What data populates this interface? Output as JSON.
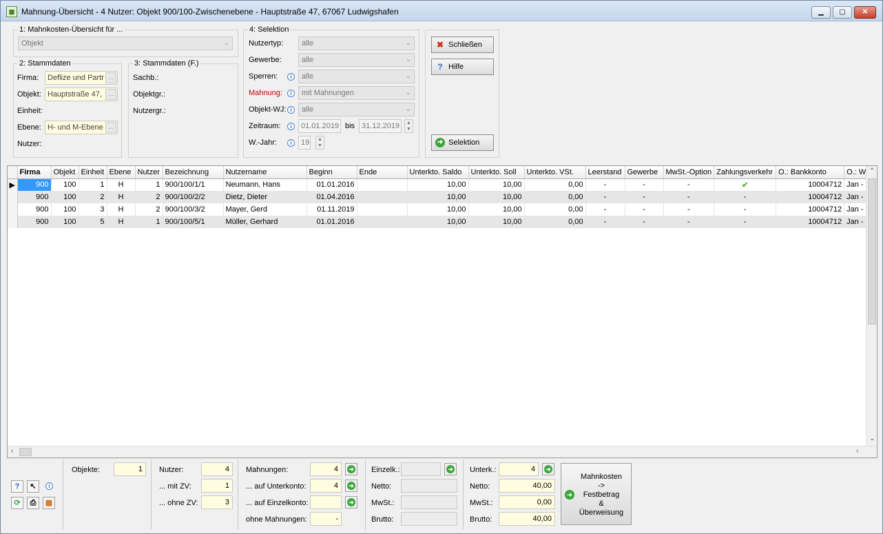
{
  "window": {
    "title": "Mahnung-Übersicht - 4 Nutzer:  Objekt 900/100-Zwischenebene - Hauptstraße 47, 67067 Ludwigshafen",
    "icon_name": "app-icon",
    "min_label": "▁",
    "max_label": "▢",
    "close_label": "✕"
  },
  "group1": {
    "title": "1: Mahnkosten-Übersicht für ...",
    "combo_value": "Objekt"
  },
  "group2": {
    "title": "2: Stammdaten",
    "firma_label": "Firma:",
    "firma_value": "Deflize und Partr",
    "objekt_label": "Objekt:",
    "objekt_value": "Hauptstraße 47,",
    "einheit_label": "Einheit:",
    "ebene_label": "Ebene:",
    "ebene_value": "H- und M-Ebene",
    "nutzer_label": "Nutzer:",
    "dots": "..."
  },
  "group3": {
    "title": "3: Stammdaten (F.)",
    "sachb_label": "Sachb.:",
    "objektgr_label": "Objektgr.:",
    "nutzergr_label": "Nutzergr.:"
  },
  "group4": {
    "title": "4: Selektion",
    "nutzertyp_label": "Nutzertyp:",
    "nutzertyp_value": "alle",
    "gewerbe_label": "Gewerbe:",
    "gewerbe_value": "alle",
    "sperren_label": "Sperren:",
    "sperren_value": "alle",
    "mahnung_label": "Mahnung:",
    "mahnung_value": "mit Mahnungen",
    "objektwj_label": "Objekt-WJ:",
    "objektwj_value": "alle",
    "zeitraum_label": "Zeitraum:",
    "date_from": "01.01.2019",
    "bis_label": "bis",
    "date_to": "31.12.2019",
    "wjahr_label": "W.-Jahr:",
    "wjahr_value": "19",
    "arrow": "⌄",
    "info": "i",
    "spin_up": "▲",
    "spin_down": "▼",
    "mahnung_color": "#c00000"
  },
  "buttons": {
    "schliessen": "Schließen",
    "hilfe": "Hilfe",
    "selektion": "Selektion",
    "close_icon": "✖",
    "help_icon": "?",
    "go_icon": "➜",
    "close_icon_color": "#d03020",
    "help_icon_color": "#2a64c0"
  },
  "grid": {
    "columns": [
      "Firma",
      "Objekt",
      "Einheit",
      "Ebene",
      "Nutzer",
      "Bezeichnung",
      "Nutzername",
      "Beginn",
      "Ende",
      "Unterkto. Saldo",
      "Unterkto. Soll",
      "Unterkto. VSt.",
      "Leerstand",
      "Gewerbe",
      "MwSt.-Option",
      "Zahlungsverkehr",
      "O.: Bankkonto",
      "O.: WJ"
    ],
    "rows": [
      [
        "900",
        "100",
        "1",
        "H",
        "1",
        "900/100/1/1",
        "Neumann, Hans",
        "01.01.2016",
        "",
        "10,00",
        "10,00",
        "0,00",
        "-",
        "-",
        "-",
        "✔",
        "10004712",
        "Jan - D"
      ],
      [
        "900",
        "100",
        "2",
        "H",
        "2",
        "900/100/2/2",
        "Dietz, Dieter",
        "01.04.2016",
        "",
        "10,00",
        "10,00",
        "0,00",
        "-",
        "-",
        "-",
        "-",
        "10004712",
        "Jan - D"
      ],
      [
        "900",
        "100",
        "3",
        "H",
        "2",
        "900/100/3/2",
        "Mayer, Gerd",
        "01.11.2019",
        "",
        "10,00",
        "10,00",
        "0,00",
        "-",
        "-",
        "-",
        "-",
        "10004712",
        "Jan - D"
      ],
      [
        "900",
        "100",
        "5",
        "H",
        "1",
        "900/100/5/1",
        "Müller, Gerhard",
        "01.01.2016",
        "",
        "10,00",
        "10,00",
        "0,00",
        "-",
        "-",
        "-",
        "-",
        "10004712",
        "Jan - D"
      ]
    ],
    "current_row_marker": "▶",
    "scroll_up": "⌃",
    "scroll_down": "⌄",
    "scroll_left": "‹",
    "scroll_right": "›",
    "check_color": "#5aa82a"
  },
  "footer": {
    "tools": {
      "help": "?",
      "pointer": "↖",
      "info": "i",
      "refresh": "⟳",
      "print": "⎙",
      "grid": "▦"
    },
    "objekte_label": "Objekte:",
    "objekte_value": "1",
    "nutzer_label": "Nutzer:",
    "nutzer_value": "4",
    "mit_zv_label": "... mit ZV:",
    "mit_zv_value": "1",
    "ohne_zv_label": "... ohne ZV:",
    "ohne_zv_value": "3",
    "mahnungen_label": "Mahnungen:",
    "mahnungen_value": "4",
    "auf_unterkonto_label": "... auf Unterkonto:",
    "auf_unterkonto_value": "4",
    "auf_einzelkonto_label": "... auf Einzelkonto:",
    "auf_einzelkonto_value": "",
    "ohne_mahnungen_label": "ohne Mahnungen:",
    "ohne_mahnungen_value": "-",
    "einzelk_label": "Einzelk.:",
    "einzelk_value": "",
    "netto_label": "Netto:",
    "mwst_label": "MwSt.:",
    "brutto_label": "Brutto:",
    "e_netto": "",
    "e_mwst": "",
    "e_brutto": "",
    "unterk_label": "Unterk.:",
    "unterk_value": "4",
    "u_netto": "40,00",
    "u_mwst": "0,00",
    "u_brutto": "40,00",
    "go": "➜",
    "big_button": [
      "Mahnkosten",
      "->",
      "Festbetrag",
      "&",
      "Überweisung"
    ]
  }
}
